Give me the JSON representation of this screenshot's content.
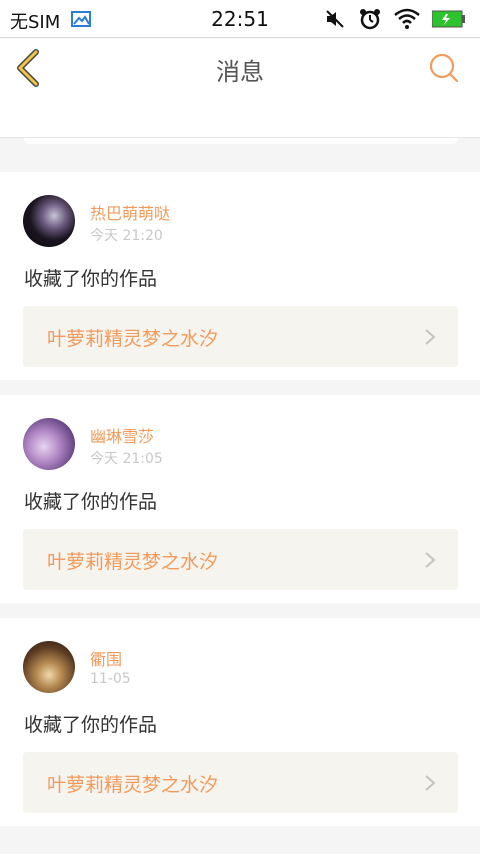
{
  "status_bar": {
    "carrier": "无SIM",
    "time": "22:51"
  },
  "header": {
    "title": "消息"
  },
  "colors": {
    "accent": "#f19a5b",
    "back_icon": "#f5c542",
    "work_bg": "#f6f4ee",
    "battery": "#2fc22f"
  },
  "messages": [
    {
      "username": "热巴萌萌哒",
      "time": "今天 21:20",
      "action": "收藏了你的作品",
      "work_title": "叶萝莉精灵梦之水汐",
      "avatar_icon": "avatar-dark-girl"
    },
    {
      "username": "幽琳雪莎",
      "time": "今天 21:05",
      "action": "收藏了你的作品",
      "work_title": "叶萝莉精灵梦之水汐",
      "avatar_icon": "avatar-purple-fantasy"
    },
    {
      "username": "衢围",
      "time": "11-05",
      "action": "收藏了你的作品",
      "work_title": "叶萝莉精灵梦之水汐",
      "avatar_icon": "avatar-open-book"
    }
  ]
}
